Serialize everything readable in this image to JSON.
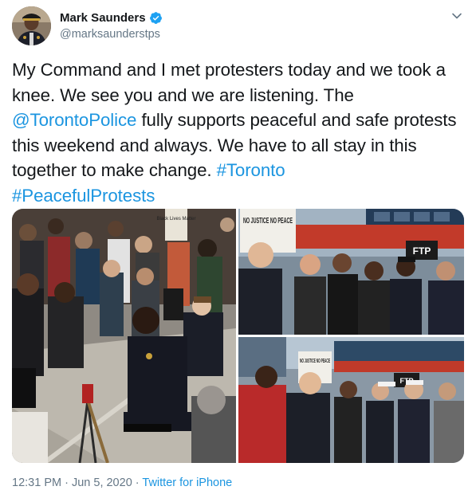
{
  "author": {
    "display_name": "Mark Saunders",
    "handle": "@marksaunderstps",
    "verified": true
  },
  "icons": {
    "verified": "verified-badge-icon",
    "menu": "chevron-down-icon"
  },
  "tweet": {
    "text_part1": "My Command and I met protesters today and we took a knee. We see you and we are listening. The ",
    "mention": "@TorontoPolice",
    "text_part2": " fully supports peaceful and safe protests this weekend and always. We have to all stay in this together to make change. ",
    "hashtag1": "#Toronto",
    "hashtag2": "#PeacefulProtests"
  },
  "photo_signs": {
    "left_sign": "Black Lives Matter",
    "top_right_sign": "NO JUSTICE NO PEACE",
    "top_right_ftp": "FTP",
    "bottom_right_sign": "NO JUSTICE NO PEACE",
    "bottom_right_ftp": "FTP"
  },
  "meta": {
    "time": "12:31 PM",
    "separator": " · ",
    "date": "Jun 5, 2020",
    "source": "Twitter for iPhone"
  },
  "colors": {
    "link": "#1b95e0",
    "text": "#14171a",
    "secondary": "#657786",
    "verified": "#1da1f2"
  }
}
